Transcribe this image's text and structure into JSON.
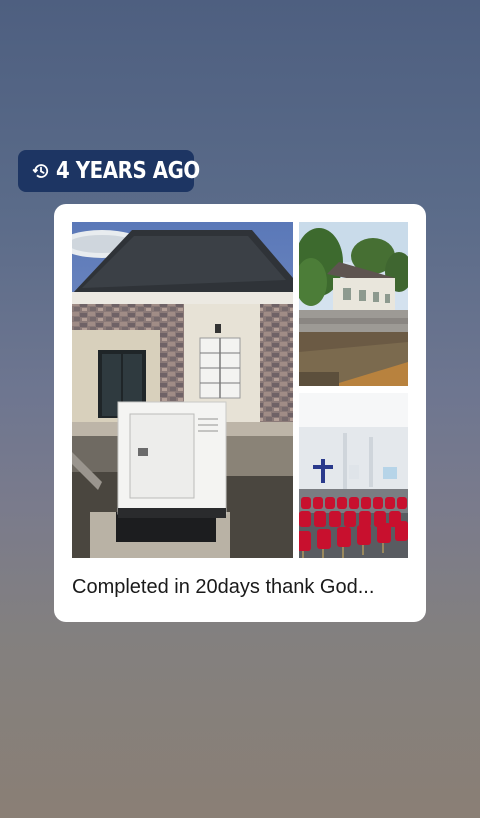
{
  "story": {
    "time_badge": {
      "icon": "history-icon",
      "label": "4 YEARS AGO"
    },
    "memory_card": {
      "photos": [
        {
          "subject": "bungalow-with-generator"
        },
        {
          "subject": "building-exterior-wall"
        },
        {
          "subject": "church-hall-red-chairs"
        }
      ],
      "caption": "Completed in 20days thank God..."
    }
  },
  "colors": {
    "badge_bg": "#1d3563",
    "card_bg": "#ffffff"
  }
}
